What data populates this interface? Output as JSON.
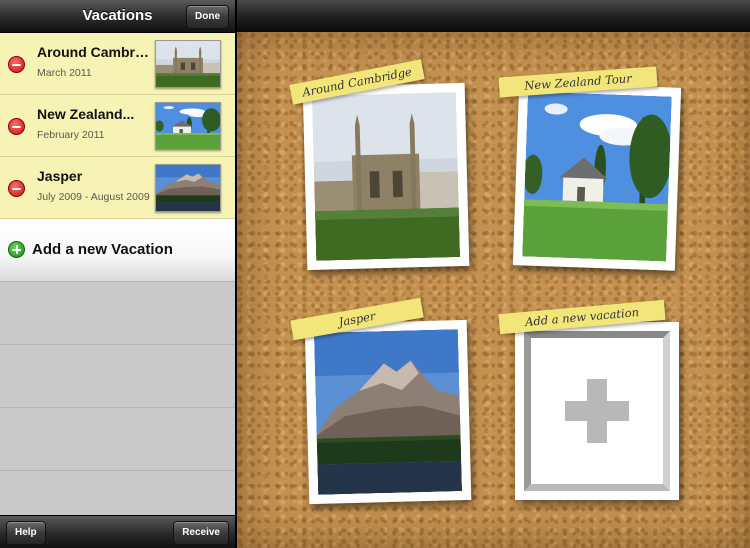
{
  "sidebar": {
    "title": "Vacations",
    "done_label": "Done",
    "vacations": [
      {
        "title": "Around Cambri...",
        "date": "March 2011",
        "thumb_icon": "cambridge-photo"
      },
      {
        "title": "New Zealand...",
        "date": "February 2011",
        "thumb_icon": "new-zealand-photo"
      },
      {
        "title": "Jasper",
        "date": "July 2009 - August 2009",
        "thumb_icon": "jasper-photo"
      }
    ],
    "add_label": "Add a new Vacation",
    "help_label": "Help",
    "receive_label": "Receive"
  },
  "board": {
    "cards": [
      {
        "caption": "Around Cambridge",
        "photo_icon": "cambridge-photo"
      },
      {
        "caption": "New Zealand Tour",
        "photo_icon": "new-zealand-photo"
      },
      {
        "caption": "Jasper",
        "photo_icon": "jasper-photo"
      }
    ],
    "add_caption": "Add a new vacation"
  },
  "colors": {
    "row_highlight": "#f7f3b5",
    "cork": "#c4914f",
    "tape": "#f2e67a",
    "delete": "#c41414",
    "add": "#218a17"
  }
}
